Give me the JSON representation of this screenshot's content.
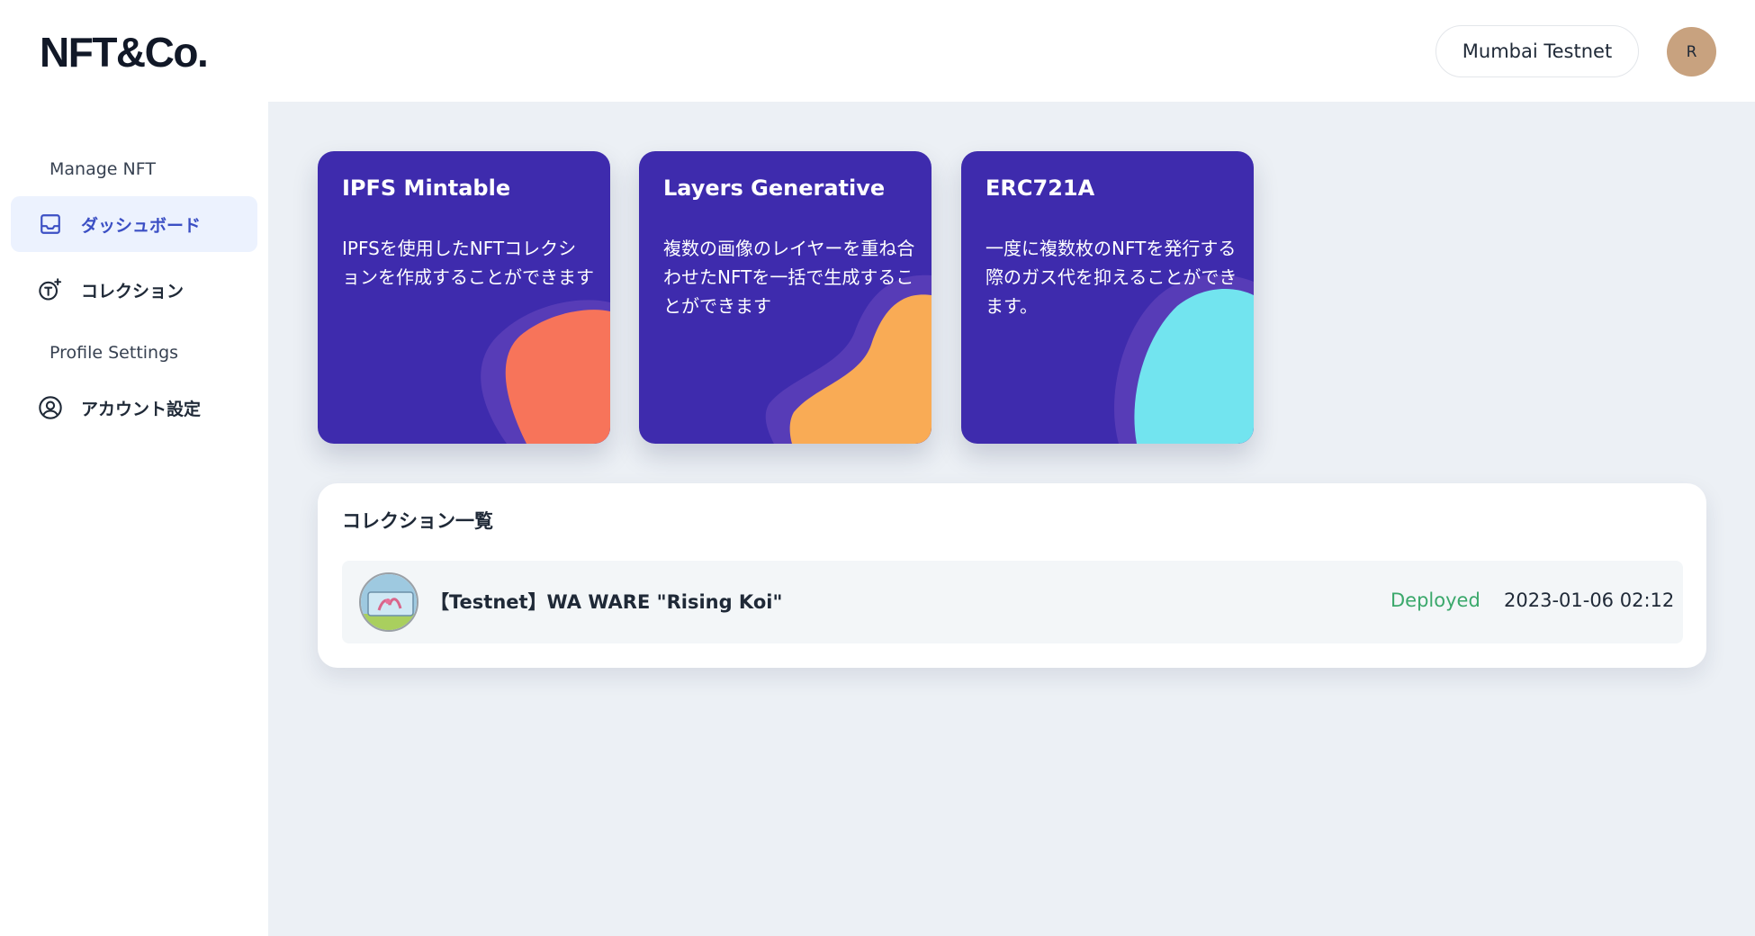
{
  "header": {
    "logo": "NFT&Co.",
    "network_label": "Mumbai Testnet",
    "avatar_initial": "R"
  },
  "sidebar": {
    "sections": [
      {
        "label": "Manage NFT",
        "items": [
          {
            "label": "ダッシュボード",
            "icon": "inbox-icon",
            "active": true
          },
          {
            "label": "コレクション",
            "icon": "token-sparkle-icon",
            "active": false
          }
        ]
      },
      {
        "label": "Profile Settings",
        "items": [
          {
            "label": "アカウント設定",
            "icon": "user-circle-icon",
            "active": false
          }
        ]
      }
    ]
  },
  "cards": [
    {
      "title": "IPFS Mintable",
      "description": "IPFSを使用したNFTコレクションを作成することができます",
      "accent_color": "#f7745a"
    },
    {
      "title": "Layers Generative",
      "description": "複数の画像のレイヤーを重ね合わせたNFTを一括で生成することができます",
      "accent_color": "#f9ab55"
    },
    {
      "title": "ERC721A",
      "description": "一度に複数枚のNFTを発行する際のガス代を抑えることができます。",
      "accent_color": "#72e4ef"
    }
  ],
  "collections": {
    "title": "コレクション一覧",
    "items": [
      {
        "name": "【Testnet】WA WARE \"Rising Koi\"",
        "status": "Deployed",
        "date": "2023-01-06 02:12"
      }
    ]
  },
  "colors": {
    "card_bg": "#3e2bad",
    "main_bg": "#ecf0f5",
    "active_nav_bg": "#ecf2fe",
    "active_nav_text": "#3b4fc4",
    "status_deployed": "#3aa86b"
  }
}
